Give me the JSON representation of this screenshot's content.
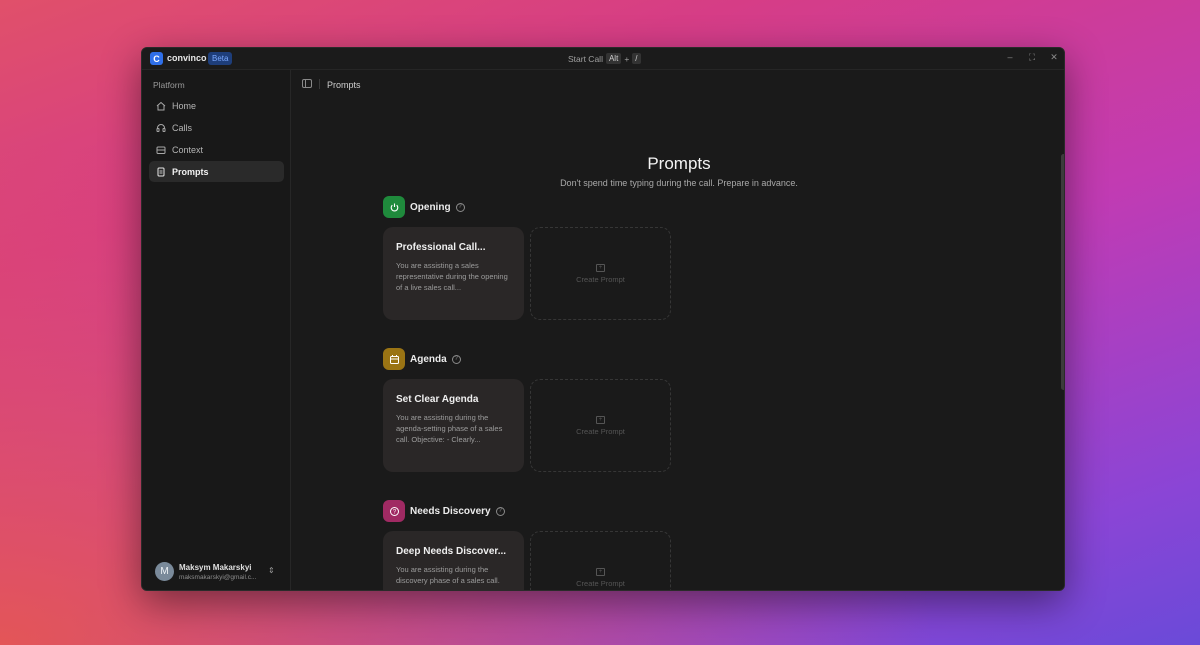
{
  "app": {
    "logo_letter": "C",
    "name": "convinco",
    "badge": "Beta"
  },
  "titlebar": {
    "start_call": "Start Call",
    "shortcut_key1": "Alt",
    "shortcut_plus": "+",
    "shortcut_key2": "/",
    "minimize": "–",
    "maximize": "⛶",
    "close": "✕"
  },
  "sidebar": {
    "heading": "Platform",
    "items": [
      {
        "label": "Home",
        "icon": "home-icon"
      },
      {
        "label": "Calls",
        "icon": "headset-icon"
      },
      {
        "label": "Context",
        "icon": "database-icon"
      },
      {
        "label": "Prompts",
        "icon": "document-icon",
        "active": true
      }
    ],
    "user": {
      "initial": "M",
      "name": "Maksym Makarskyi",
      "email": "maksmakarskyi@gmail.c..."
    }
  },
  "breadcrumb": "Prompts",
  "page": {
    "title": "Prompts",
    "subtitle": "Don't spend time typing during the call. Prepare in advance."
  },
  "sections": [
    {
      "title": "Opening",
      "icon": "power-icon",
      "color": "#1f8a3c",
      "prompt_title": "Professional Call...",
      "prompt_desc": "You are assisting a sales representative during the opening of a live sales call...",
      "create_label": "Create Prompt"
    },
    {
      "title": "Agenda",
      "icon": "calendar-icon",
      "color": "#9a7414",
      "prompt_title": "Set Clear Agenda",
      "prompt_desc": "You are assisting during the agenda-setting phase of a sales call. Objective: - Clearly...",
      "create_label": "Create Prompt"
    },
    {
      "title": "Needs Discovery",
      "icon": "question-icon",
      "color": "#a02a63",
      "prompt_title": "Deep Needs Discover...",
      "prompt_desc": "You are assisting during the discovery phase of a sales call.",
      "create_label": "Create Prompt"
    }
  ]
}
